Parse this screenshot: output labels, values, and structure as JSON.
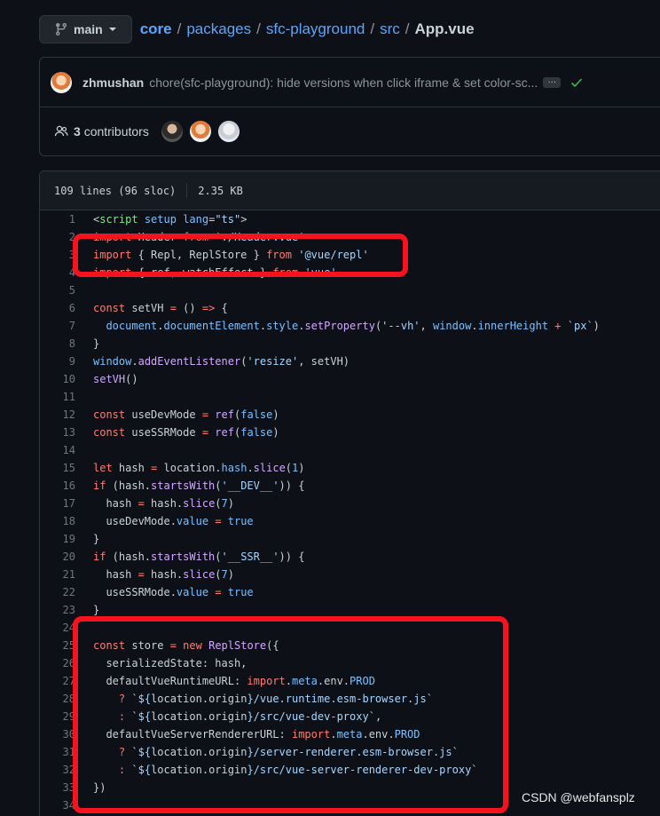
{
  "branch": {
    "name": "main"
  },
  "breadcrumb": {
    "parts": [
      "core",
      "packages",
      "sfc-playground",
      "src"
    ],
    "file": "App.vue"
  },
  "commit": {
    "author": "zhmushan",
    "message": "chore(sfc-playground): hide versions when click iframe & set color-sc...",
    "ellipsis": "…"
  },
  "contributors": {
    "count": "3",
    "label": "contributors"
  },
  "file_info": {
    "lines": "109 lines (96 sloc)",
    "size": "2.35 KB"
  },
  "code_lines": [
    "1",
    "2",
    "3",
    "4",
    "5",
    "6",
    "7",
    "8",
    "9",
    "10",
    "11",
    "12",
    "13",
    "14",
    "15",
    "16",
    "17",
    "18",
    "19",
    "20",
    "21",
    "22",
    "23",
    "24",
    "25",
    "26",
    "27",
    "28",
    "29",
    "30",
    "31",
    "32",
    "33",
    "34"
  ],
  "watermark": "CSDN @webfansplz",
  "colors": {
    "highlight": "#f5141e",
    "link": "#58a6ff",
    "bg": "#0d1117"
  }
}
